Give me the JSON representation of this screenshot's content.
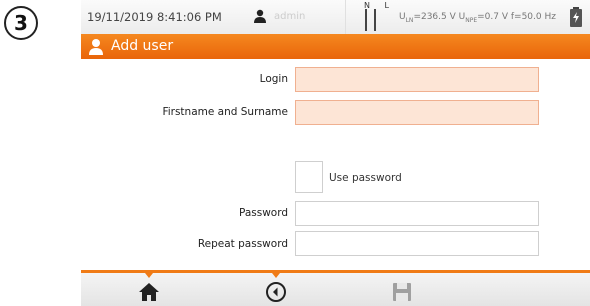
{
  "step": "3",
  "status": {
    "datetime": "19/11/2019 8:41:06 PM",
    "user": "admin",
    "nl_labels": "N L",
    "measure": {
      "uln_sub": "LN",
      "uln_val": "=236.5 V",
      "unpe_sub": "NPE",
      "unpe_val": "=0.7 V",
      "freq": "f=50.0 Hz"
    },
    "icons": [
      "user-icon",
      "phase-indicator-icon",
      "battery-icon"
    ]
  },
  "title": {
    "icon": "user-icon",
    "text": "Add user"
  },
  "form": {
    "login_label": "Login",
    "login_value": "",
    "name_label": "Firstname and Surname",
    "name_value": "",
    "use_password_label": "Use password",
    "use_password_checked": false,
    "password_label": "Password",
    "password_value": "",
    "repeat_password_label": "Repeat password",
    "repeat_password_value": ""
  },
  "toolbar": {
    "icons": [
      "home-icon",
      "back-icon",
      "save-icon"
    ]
  },
  "colors": {
    "accent": "#f07b16",
    "required_field": "#fde5d6",
    "disabled_icon": "#a0a0a0"
  }
}
